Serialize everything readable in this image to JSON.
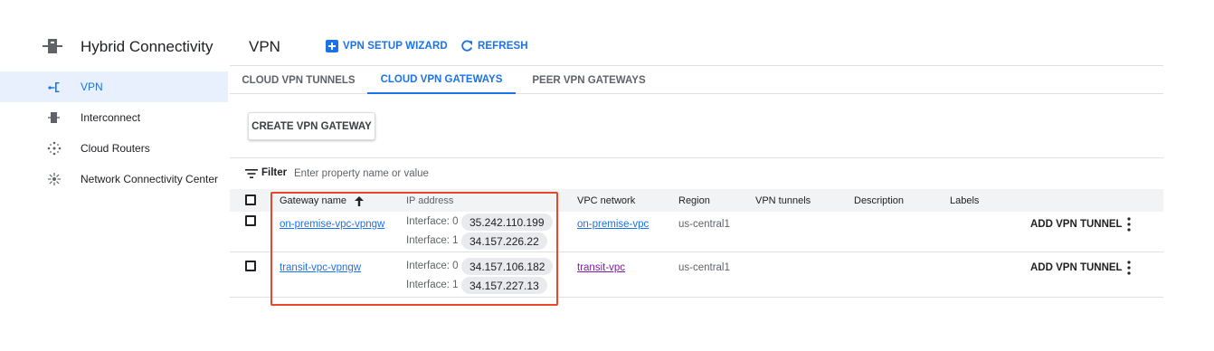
{
  "sidebar": {
    "title": "Hybrid Connectivity",
    "items": [
      {
        "label": "VPN",
        "icon": "vpn-icon",
        "active": true
      },
      {
        "label": "Interconnect",
        "icon": "interconnect-icon",
        "active": false
      },
      {
        "label": "Cloud Routers",
        "icon": "cloud-router-icon",
        "active": false
      },
      {
        "label": "Network Connectivity Center",
        "icon": "hub-icon",
        "active": false
      }
    ]
  },
  "header": {
    "title": "VPN",
    "wizard_label": "VPN SETUP WIZARD",
    "refresh_label": "REFRESH"
  },
  "tabs": [
    {
      "label": "CLOUD VPN TUNNELS",
      "active": false
    },
    {
      "label": "CLOUD VPN GATEWAYS",
      "active": true
    },
    {
      "label": "PEER VPN GATEWAYS",
      "active": false
    }
  ],
  "actions": {
    "create_label": "CREATE VPN GATEWAY"
  },
  "filter": {
    "label": "Filter",
    "placeholder": "Enter property name or value"
  },
  "table": {
    "columns": [
      "Gateway name",
      "IP address",
      "VPC network",
      "Region",
      "VPN tunnels",
      "Description",
      "Labels"
    ],
    "rows": [
      {
        "gateway": "on-premise-vpc-vpngw",
        "interfaces": [
          {
            "label": "Interface: 0",
            "ip": "35.242.110.199"
          },
          {
            "label": "Interface: 1",
            "ip": "34.157.226.22"
          }
        ],
        "network": "on-premise-vpc",
        "region": "us-central1",
        "action": "ADD VPN TUNNEL"
      },
      {
        "gateway": "transit-vpc-vpngw",
        "interfaces": [
          {
            "label": "Interface: 0",
            "ip": "34.157.106.182"
          },
          {
            "label": "Interface: 1",
            "ip": "34.157.227.13"
          }
        ],
        "network": "transit-vpc",
        "region": "us-central1",
        "action": "ADD VPN TUNNEL"
      }
    ]
  },
  "colors": {
    "accent": "#1a73e8",
    "visited_link": "#7b1fa2",
    "highlight": "#e8472a",
    "active_bg": "#e8f0fe"
  }
}
